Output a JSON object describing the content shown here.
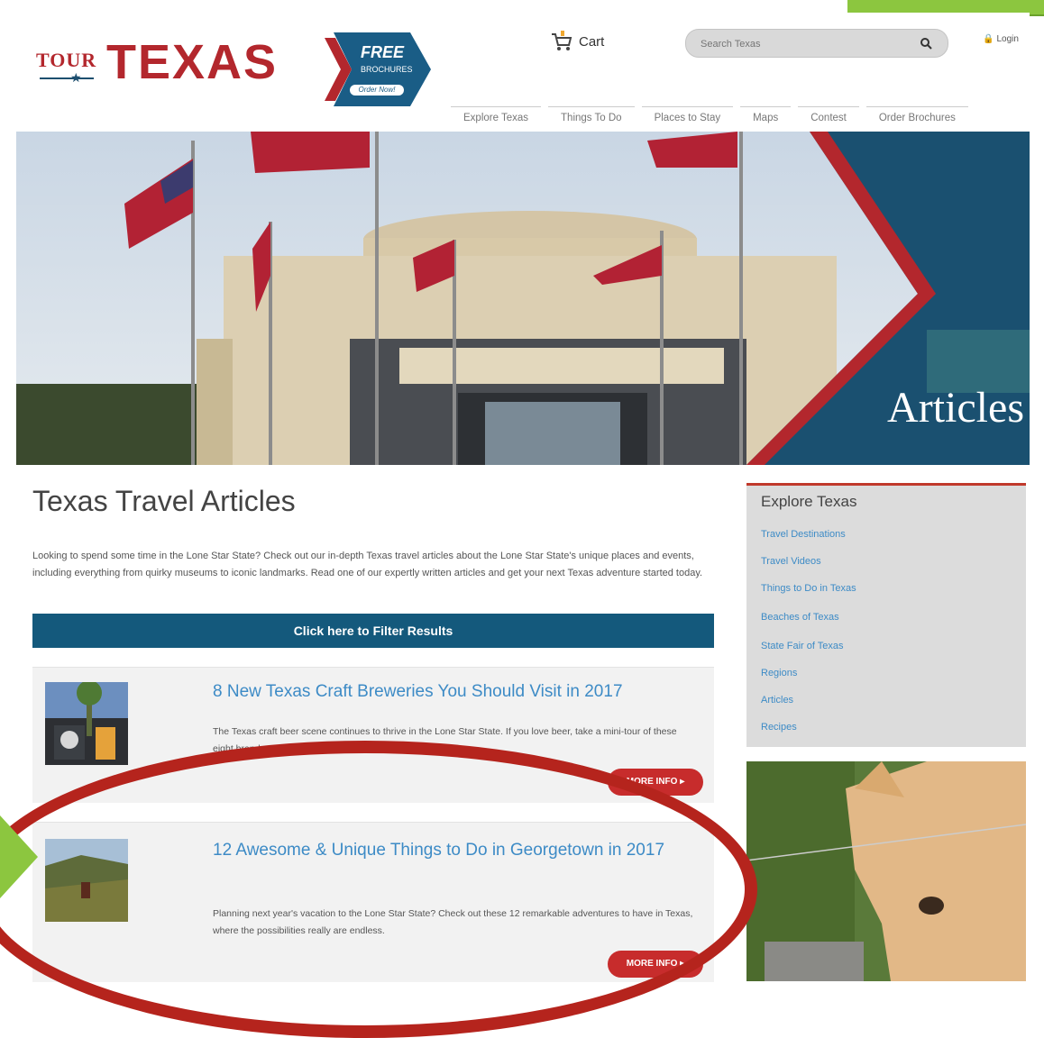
{
  "header": {
    "logo": {
      "tour": "TOUR",
      "texas": "TEXAS",
      "badge_free": "FREE",
      "badge_brochures": "BROCHURES",
      "badge_order": "Order Now!"
    },
    "cart_label": "Cart",
    "search": {
      "placeholder": "Search Texas"
    },
    "login_label": "Login",
    "nav": [
      "Explore Texas",
      "Things To Do",
      "Places to Stay",
      "Maps",
      "Contest",
      "Order Brochures"
    ]
  },
  "hero": {
    "title": "Articles"
  },
  "main": {
    "title": "Texas Travel Articles",
    "intro": "Looking to spend some time in the Lone Star State? Check out our in-depth Texas travel articles about the Lone Star State's unique places and events, including everything from quirky museums to iconic landmarks. Read one of our expertly written articles and get your next Texas adventure started today.",
    "filter_label": "Click here to Filter Results",
    "articles": [
      {
        "title": "8 New Texas Craft Breweries You Should Visit in 2017",
        "description": "The Texas craft beer scene continues to thrive in the Lone Star State. If you love beer, take a mini-tour of these eight brand new breweries in Texas.",
        "button": "MORE INFO ▸"
      },
      {
        "title": "12 Awesome & Unique Things to Do in Georgetown in 2017",
        "description": "Planning next year's vacation to the Lone Star State? Check out these 12 remarkable adventures to have in Texas, where the possibilities really are endless.",
        "button": "MORE INFO ▸"
      }
    ]
  },
  "sidebar": {
    "title": "Explore Texas",
    "links": [
      "Travel Destinations",
      "Travel Videos",
      "Things to Do in Texas",
      "Beaches of Texas",
      "State Fair of Texas",
      "Regions",
      "Articles",
      "Recipes"
    ]
  },
  "colors": {
    "brand_red": "#b3272d",
    "brand_blue": "#14597c",
    "link_blue": "#3d8bc6",
    "button_red": "#c72c2c",
    "annotation_red": "#b5241d",
    "annotation_green": "#8cc63f"
  }
}
